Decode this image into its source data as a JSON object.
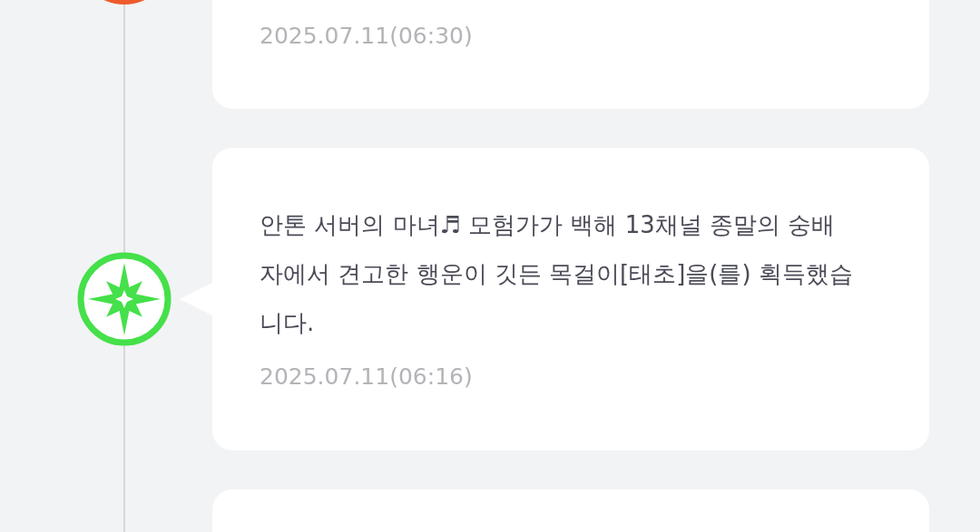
{
  "timeline": [
    {
      "icon": {
        "kind": "orb",
        "color": "#ee5a2c"
      },
      "date": "2025.07.11(06:30)"
    },
    {
      "icon": {
        "kind": "star",
        "color": "#45e04a"
      },
      "message": "안톤 서버의 마녀♬ 모험가가 백해 13채널 종말의 숭배자에서 견고한 행운이 깃든 목걸이[태초]을(를) 획득했습니다.",
      "date": "2025.07.11(06:16)"
    }
  ]
}
